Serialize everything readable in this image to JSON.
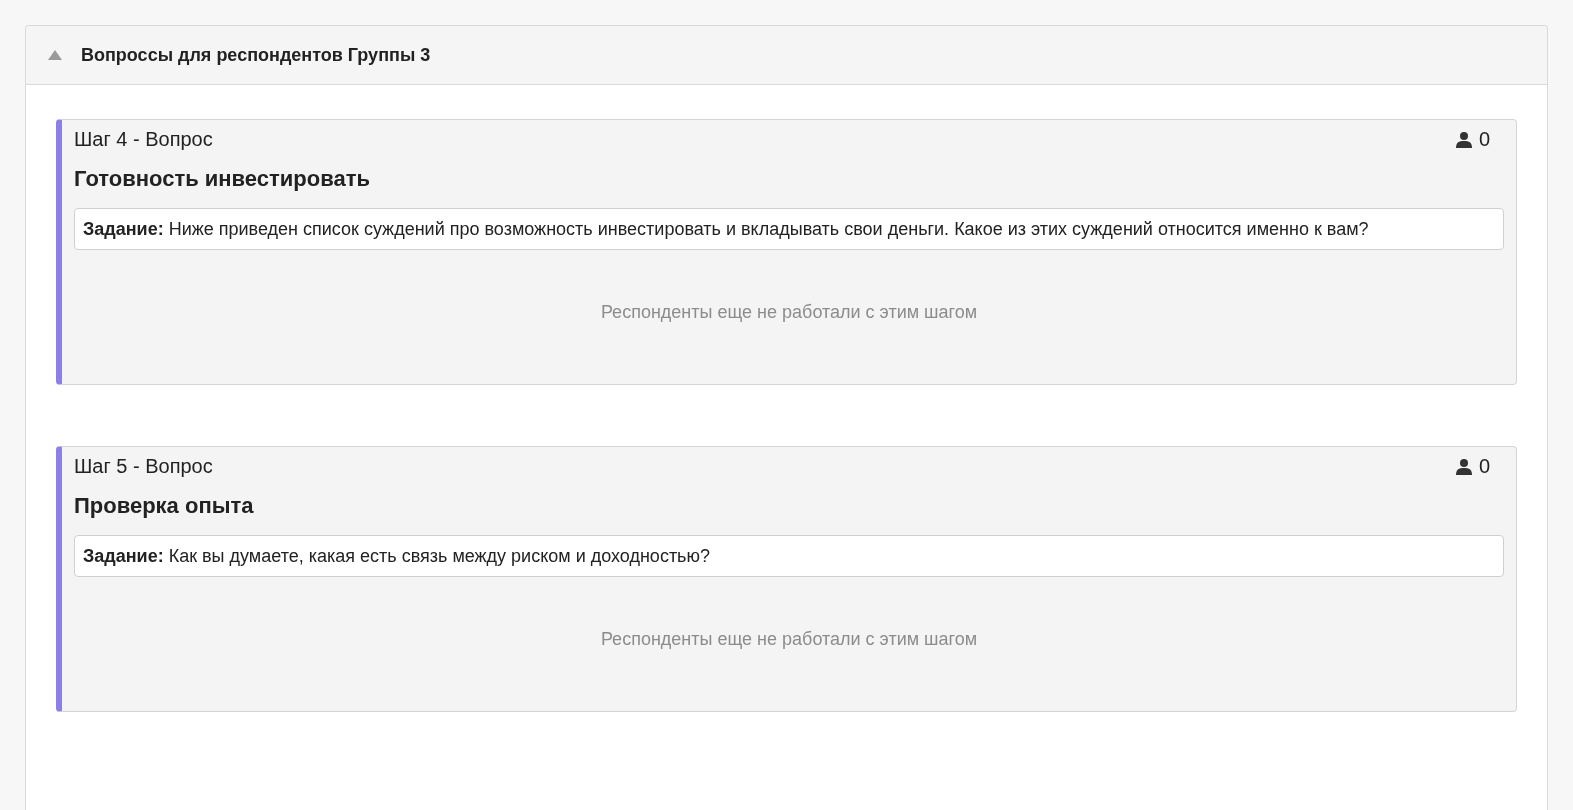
{
  "panel": {
    "title": "Вопроссы для респондентов Группы 3",
    "expanded": true
  },
  "steps": [
    {
      "step_label": "Шаг 4 - Вопрос",
      "count": "0",
      "title": "Готовность инвестировать",
      "task": "**Задание:** Ниже приведен список суждений про возможность инвестировать и вкладывать свои деньги. Какое из этих суждений относится именно к вам?",
      "empty_message": "Респонденты еще не работали с этим шагом"
    },
    {
      "step_label": "Шаг 5 - Вопрос",
      "count": "0",
      "title": "Проверка опыта",
      "task": "**Задание:** Как вы думаете, какая есть связь между риском и доходностью?",
      "empty_message": "Респонденты еще не работали с этим шагом"
    }
  ]
}
